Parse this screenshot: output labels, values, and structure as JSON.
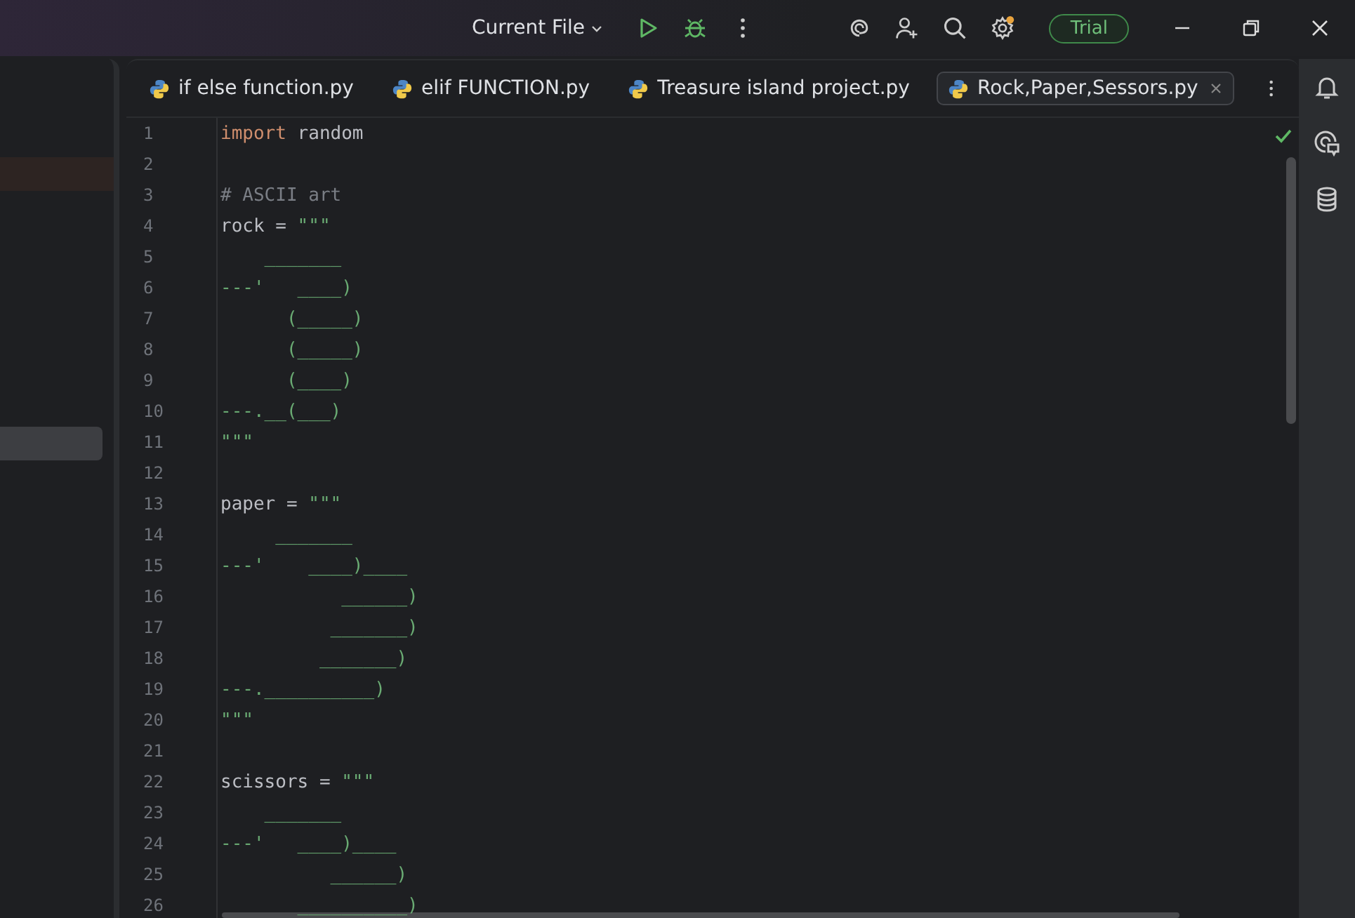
{
  "toolbar": {
    "run_config": "Current File",
    "trial": "Trial"
  },
  "tabs": [
    {
      "label": "if else function.py",
      "selected": false
    },
    {
      "label": "elif FUNCTION.py",
      "selected": false
    },
    {
      "label": "Treasure island project.py",
      "selected": false
    },
    {
      "label": "Rock,Paper,Sessors.py",
      "selected": true
    }
  ],
  "code": [
    {
      "number": "1",
      "segments": [
        {
          "kind": "keyword",
          "text": "import"
        },
        {
          "kind": "plain",
          "text": " random"
        }
      ]
    },
    {
      "number": "2"
    },
    {
      "number": "3",
      "segments": [
        {
          "kind": "comment",
          "text": "# ASCII art"
        }
      ]
    },
    {
      "number": "4",
      "segments": [
        {
          "kind": "plain",
          "text": "rock = "
        },
        {
          "kind": "string",
          "text": "\"\"\""
        }
      ]
    },
    {
      "number": "5",
      "segments": [
        {
          "kind": "string",
          "text": "    _______"
        }
      ]
    },
    {
      "number": "6",
      "segments": [
        {
          "kind": "string",
          "text": "---'   ____)"
        }
      ]
    },
    {
      "number": "7",
      "segments": [
        {
          "kind": "string",
          "text": "      (_____)"
        }
      ]
    },
    {
      "number": "8",
      "segments": [
        {
          "kind": "string",
          "text": "      (_____)"
        }
      ]
    },
    {
      "number": "9",
      "segments": [
        {
          "kind": "string",
          "text": "      (____)"
        }
      ]
    },
    {
      "number": "10",
      "segments": [
        {
          "kind": "string",
          "text": "---.__(___)"
        }
      ]
    },
    {
      "number": "11",
      "segments": [
        {
          "kind": "string",
          "text": "\"\"\""
        }
      ]
    },
    {
      "number": "12"
    },
    {
      "number": "13",
      "segments": [
        {
          "kind": "plain",
          "text": "paper = "
        },
        {
          "kind": "string",
          "text": "\"\"\""
        }
      ]
    },
    {
      "number": "14",
      "segments": [
        {
          "kind": "string",
          "text": "     _______"
        }
      ]
    },
    {
      "number": "15",
      "segments": [
        {
          "kind": "string",
          "text": "---'    ____)____"
        }
      ]
    },
    {
      "number": "16",
      "segments": [
        {
          "kind": "string",
          "text": "           ______)"
        }
      ]
    },
    {
      "number": "17",
      "segments": [
        {
          "kind": "string",
          "text": "          _______)"
        }
      ]
    },
    {
      "number": "18",
      "segments": [
        {
          "kind": "string",
          "text": "         _______)"
        }
      ]
    },
    {
      "number": "19",
      "segments": [
        {
          "kind": "string",
          "text": "---.__________)"
        }
      ]
    },
    {
      "number": "20",
      "segments": [
        {
          "kind": "string",
          "text": "\"\"\""
        }
      ]
    },
    {
      "number": "21"
    },
    {
      "number": "22",
      "segments": [
        {
          "kind": "plain",
          "text": "scissors = "
        },
        {
          "kind": "string",
          "text": "\"\"\""
        }
      ]
    },
    {
      "number": "23",
      "segments": [
        {
          "kind": "string",
          "text": "    _______"
        }
      ]
    },
    {
      "number": "24",
      "segments": [
        {
          "kind": "string",
          "text": "---'   ____)____"
        }
      ]
    },
    {
      "number": "25",
      "segments": [
        {
          "kind": "string",
          "text": "          ______)"
        }
      ]
    },
    {
      "number": "26",
      "segments": [
        {
          "kind": "string",
          "text": "       __________)"
        }
      ]
    }
  ]
}
